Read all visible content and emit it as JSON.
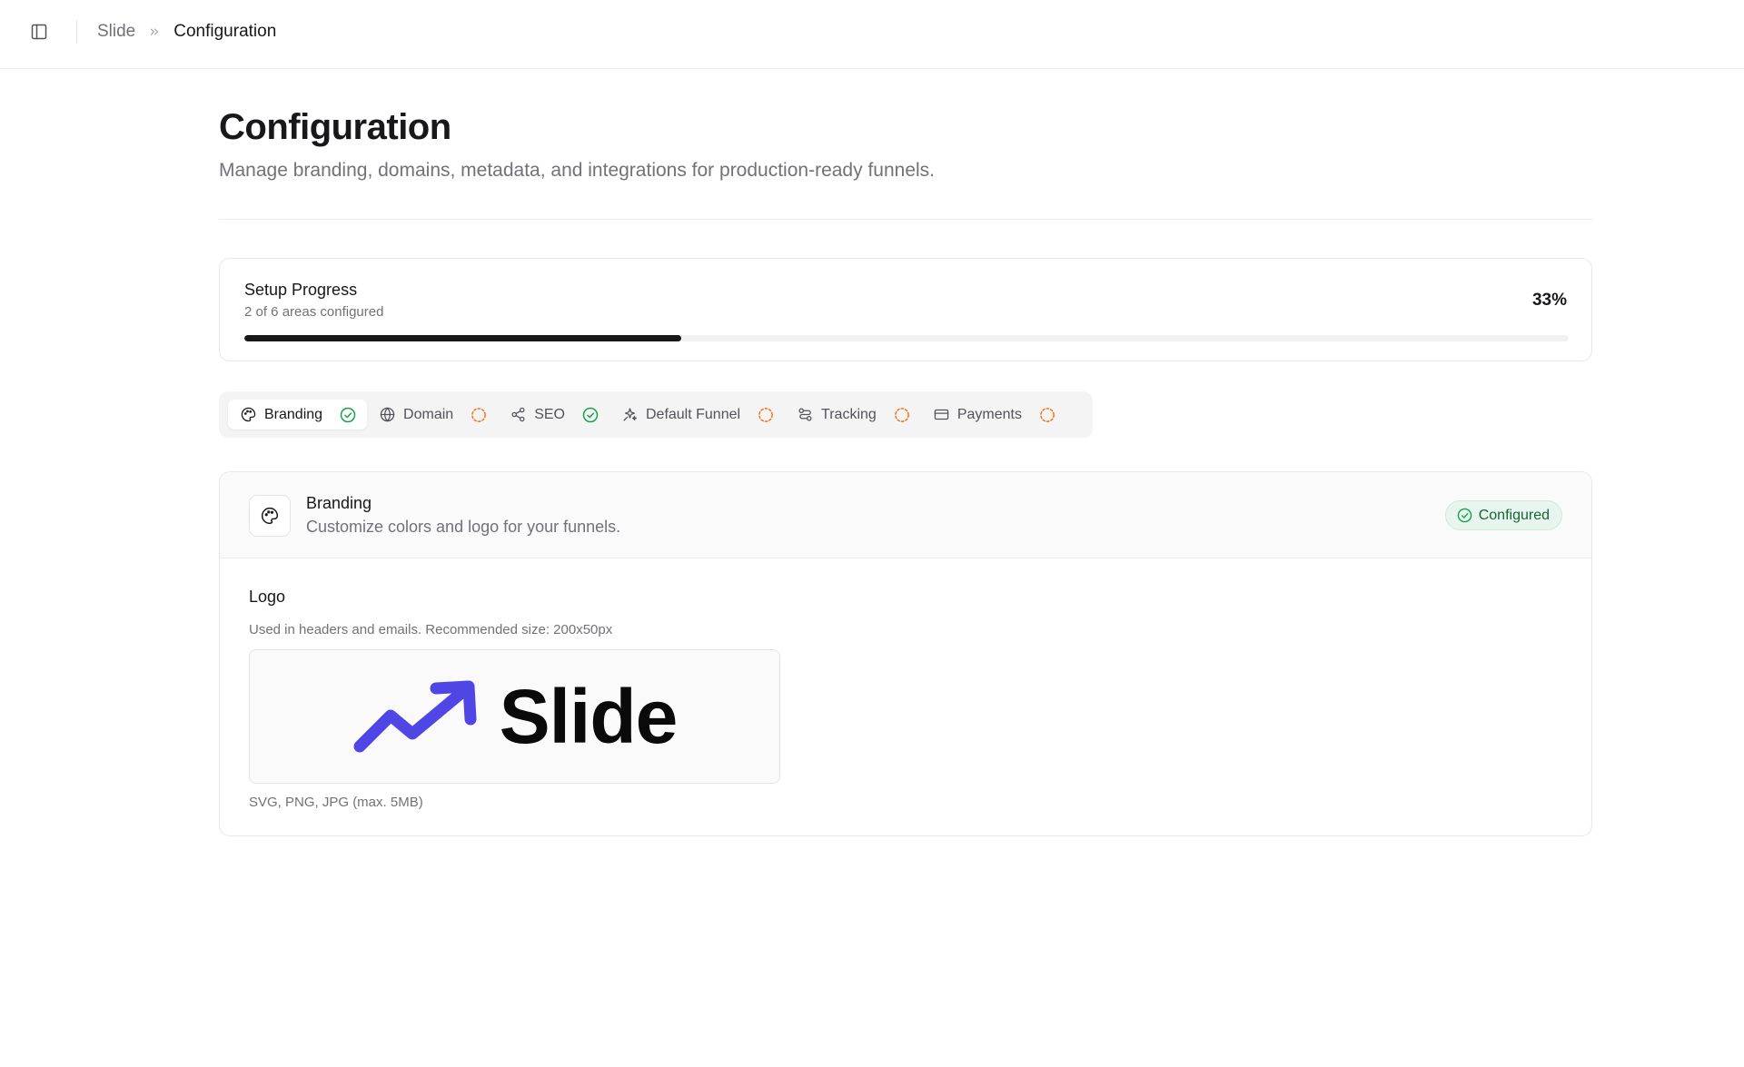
{
  "breadcrumb": {
    "app": "Slide",
    "current": "Configuration"
  },
  "header": {
    "title": "Configuration",
    "subtitle": "Manage branding, domains, metadata, and integrations for production-ready funnels."
  },
  "progress": {
    "title": "Setup Progress",
    "subtitle": "2 of 6 areas configured",
    "percent_label": "33%",
    "value": 0.33
  },
  "tabs": [
    {
      "label": "Branding",
      "icon": "palette-icon",
      "status": "configured",
      "active": true
    },
    {
      "label": "Domain",
      "icon": "globe-icon",
      "status": "pending",
      "active": false
    },
    {
      "label": "SEO",
      "icon": "share-icon",
      "status": "configured",
      "active": false
    },
    {
      "label": "Default Funnel",
      "icon": "sparkles-icon",
      "status": "pending",
      "active": false
    },
    {
      "label": "Tracking",
      "icon": "route-icon",
      "status": "pending",
      "active": false
    },
    {
      "label": "Payments",
      "icon": "credit-card-icon",
      "status": "pending",
      "active": false
    }
  ],
  "branding": {
    "title": "Branding",
    "description": "Customize colors and logo for your funnels.",
    "badge": "Configured",
    "logo_label": "Logo",
    "logo_help": "Used in headers and emails. Recommended size: 200x50px",
    "logo_text": "Slide",
    "logo_formats": "SVG, PNG, JPG (max. 5MB)"
  },
  "colors": {
    "success": "#16a34a",
    "pending": "#f97316",
    "brand_arrow": "#4f46e5",
    "progress_fill": "#18181b"
  }
}
